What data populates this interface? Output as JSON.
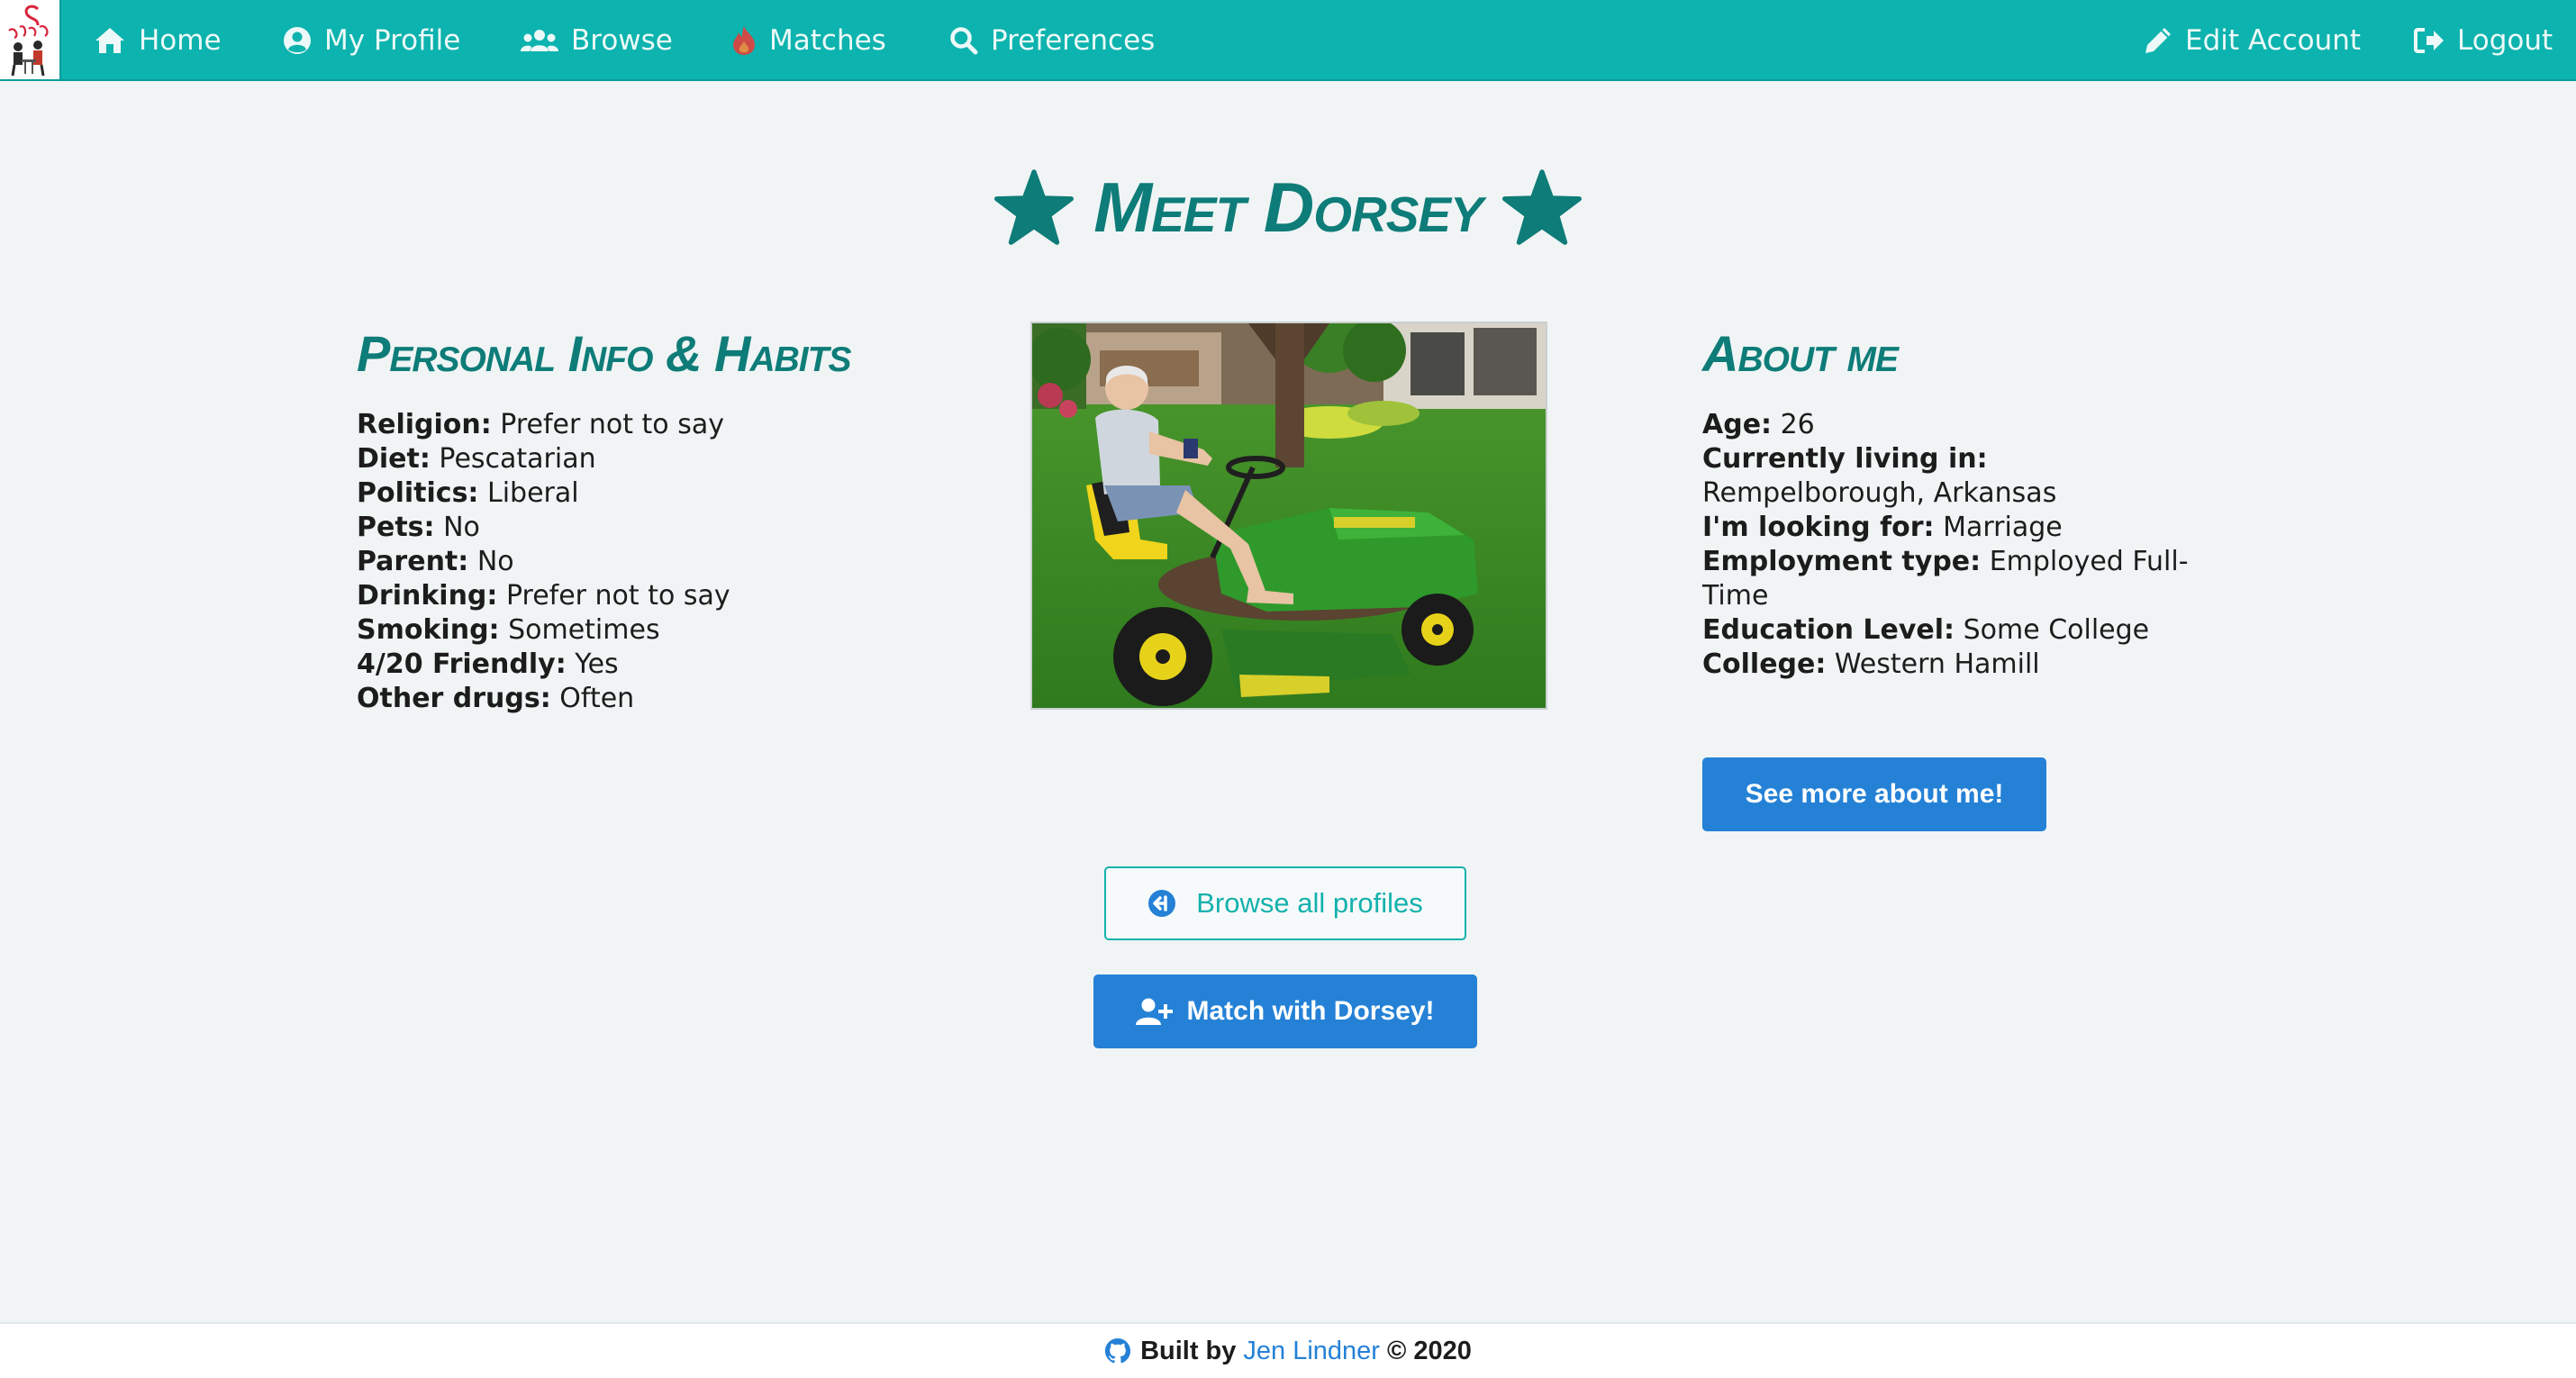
{
  "nav": {
    "brand_icon": "blind-date-logo",
    "left_items": [
      {
        "label": "Home",
        "icon": "home-icon"
      },
      {
        "label": "My Profile",
        "icon": "user-circle-icon"
      },
      {
        "label": "Browse",
        "icon": "users-icon"
      },
      {
        "label": "Matches",
        "icon": "fire-icon"
      },
      {
        "label": "Preferences",
        "icon": "search-icon"
      }
    ],
    "right_items": [
      {
        "label": "Edit Account",
        "icon": "pencil-icon"
      },
      {
        "label": "Logout",
        "icon": "sign-out-icon"
      }
    ]
  },
  "profile": {
    "title": "Meet Dorsey",
    "title_icon": "star-icon",
    "photo_alt": "Man sitting on a green riding lawn mower"
  },
  "personal": {
    "heading": "Personal Info & Habits",
    "rows": [
      {
        "label": "Religion:",
        "value": "Prefer not to say"
      },
      {
        "label": "Diet:",
        "value": "Pescatarian"
      },
      {
        "label": "Politics:",
        "value": "Liberal"
      },
      {
        "label": "Pets:",
        "value": "No"
      },
      {
        "label": "Parent:",
        "value": "No"
      },
      {
        "label": "Drinking:",
        "value": "Prefer not to say"
      },
      {
        "label": "Smoking:",
        "value": "Sometimes"
      },
      {
        "label": "4/20 Friendly:",
        "value": "Yes"
      },
      {
        "label": "Other drugs:",
        "value": "Often"
      }
    ]
  },
  "about": {
    "heading": "About me",
    "rows": [
      {
        "label": "Age:",
        "value": "26"
      },
      {
        "label": "Currently living in:",
        "value": "Rempelborough, Arkansas"
      },
      {
        "label": "I'm looking for:",
        "value": "Marriage"
      },
      {
        "label": "Employment type:",
        "value": "Employed Full-Time"
      },
      {
        "label": "Education Level:",
        "value": "Some College"
      },
      {
        "label": "College:",
        "value": "Western Hamill"
      }
    ],
    "see_more_label": "See more about me!"
  },
  "actions": {
    "browse_label": "Browse all profiles",
    "browse_icon": "arrow-circle-left-icon",
    "match_label": "Match with Dorsey!",
    "match_icon": "user-plus-icon"
  },
  "footer": {
    "prefix": "Built by",
    "author": "Jen Lindner",
    "suffix": "© 2020",
    "icon": "github-icon"
  },
  "colors": {
    "navbar": "#0db3ae",
    "heading": "#0e7c78",
    "primary_button": "#2481d6",
    "outline_button": "#14b1ad",
    "background": "#f0f4f5",
    "matches_icon": "#e0433f"
  }
}
